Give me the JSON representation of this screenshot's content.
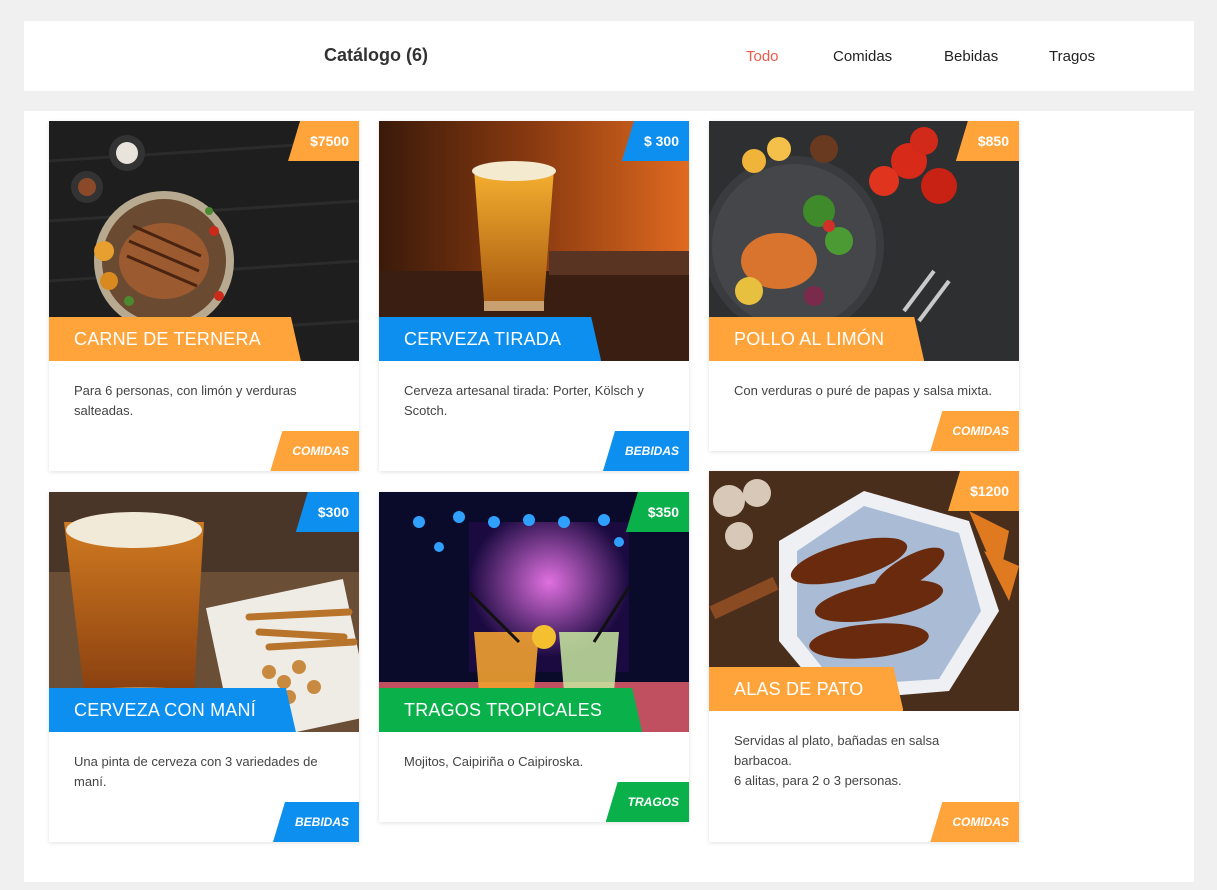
{
  "header": {
    "title": "Catálogo (6)",
    "nav": [
      "Todo",
      "Comidas",
      "Bebidas",
      "Tragos"
    ],
    "active": "Todo"
  },
  "colors": {
    "comidas": "#ffa43b",
    "bebidas": "#0d8ff0",
    "tragos": "#0ab14b",
    "active_nav": "#ef5a4a"
  },
  "items": [
    {
      "name": "CARNE DE TERNERA",
      "price": "$7500",
      "desc": [
        "Para 6 personas, con limón y verduras",
        "salteadas."
      ],
      "category": "COMIDAS"
    },
    {
      "name": "CERVEZA TIRADA",
      "price": "$ 300",
      "desc": [
        "Cerveza artesanal tirada: Porter, Kölsch y",
        "Scotch."
      ],
      "category": "BEBIDAS"
    },
    {
      "name": "POLLO AL LIMÓN",
      "price": "$850",
      "desc": [
        "Con verduras o puré de papas y salsa mixta."
      ],
      "category": "COMIDAS"
    },
    {
      "name": "CERVEZA CON MANÍ",
      "price": "$300",
      "desc": [
        "Una pinta de cerveza con 3 variedades de",
        "maní."
      ],
      "category": "BEBIDAS"
    },
    {
      "name": "TRAGOS TROPICALES",
      "price": "$350",
      "desc": [
        "Mojitos, Caipiriña o Caipiroska."
      ],
      "category": "TRAGOS"
    },
    {
      "name": "ALAS DE PATO",
      "price": "$1200",
      "desc": [
        "Servidas al plato, bañadas en salsa",
        "barbacoa.",
        "6 alitas, para 2 o 3 personas."
      ],
      "category": "COMIDAS"
    }
  ]
}
